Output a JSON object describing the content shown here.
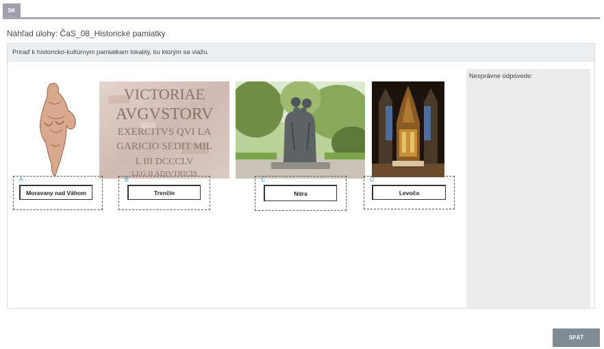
{
  "header": {
    "language_tab": "SK"
  },
  "page": {
    "title": "Náhľad úlohy: ČaS_08_Historické pamiatky"
  },
  "task": {
    "instruction": "Priraď k historicko-kultúrnym pamiatkam lokality, ku ktorým sa viažu."
  },
  "wrong_answers": {
    "label": "Nesprávne odpovede:"
  },
  "pictures": [
    {
      "name": "venus-figurine",
      "inscription": ""
    },
    {
      "name": "roman-inscription-stone",
      "inscription": [
        "VICTORIAE",
        "AVGVSTORV",
        "EXERCITVS QVI LA",
        "GARICIO SEDIT MIL",
        "L III DCCCLV",
        "LEG II ADIVTRICIS"
      ]
    },
    {
      "name": "cyril-methodius-statue",
      "inscription": ""
    },
    {
      "name": "gothic-altar",
      "inscription": ""
    }
  ],
  "dropzones": [
    {
      "letter": "A",
      "answer": "Moravany nad Váhom"
    },
    {
      "letter": "B",
      "answer": "Trenčín"
    },
    {
      "letter": "C",
      "answer": "Nitra"
    },
    {
      "letter": "D",
      "answer": "Levoča"
    }
  ],
  "footer": {
    "back_label": "SPÄŤ"
  }
}
